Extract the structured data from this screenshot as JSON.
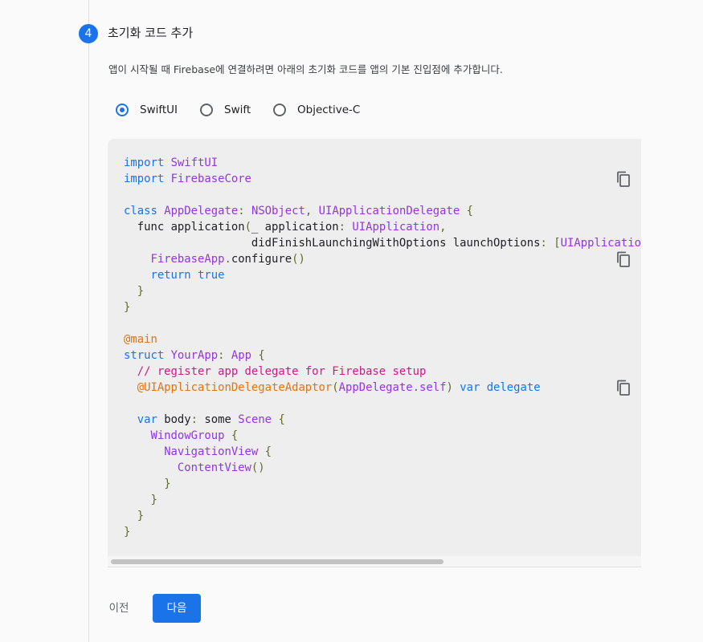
{
  "step": {
    "number": "4",
    "title": "초기화 코드 추가"
  },
  "description": "앱이 시작될 때 Firebase에 연결하려면 아래의 초기화 코드를 앱의 기본 진입점에 추가합니다.",
  "language_options": [
    {
      "label": "SwiftUI",
      "selected": true
    },
    {
      "label": "Swift",
      "selected": false
    },
    {
      "label": "Objective-C",
      "selected": false
    }
  ],
  "code_tokens": {
    "import": "import",
    "swiftui": "SwiftUI",
    "firebasecore": "FirebaseCore",
    "class": "class",
    "appdelegate": "AppDelegate",
    "colon": ":",
    "nsobject": "NSObject",
    "comma": ",",
    "uiappdelegate": "UIApplicationDelegate",
    "lbrace": "{",
    "rbrace": "}",
    "func": "func",
    "application_fn": "application",
    "lparen": "(",
    "rparen": ")",
    "underscore_application": "_ application",
    "uiapplication": "UIApplication",
    "did_finish": "didFinishLaunchingWithOptions launchOptions",
    "lbracket": "[",
    "uiapplication_cut": "UIApplicatio",
    "firebaseapp": "FirebaseApp",
    "dot": ".",
    "configure": "configure",
    "parens": "()",
    "return": "return",
    "true": "true",
    "main_attr": "@main",
    "struct": "struct",
    "yourapp": "YourApp",
    "app": "App",
    "comment": "// register app delegate for Firebase setup",
    "adaptor_attr": "@UIApplicationDelegateAdaptor",
    "self": "self",
    "var": "var",
    "delegate": "delegate",
    "body": "body",
    "some": "some",
    "scene": "Scene",
    "windowgroup": "WindowGroup",
    "navigationview": "NavigationView",
    "contentview": "ContentView"
  },
  "icons": {
    "copy": "copy-icon"
  },
  "buttons": {
    "prev": "이전",
    "next": "다음"
  },
  "colors": {
    "accent": "#1a73e8",
    "keyword": "#1a73e8",
    "type": "#9334e6",
    "attribute": "#e8710a",
    "comment": "#d01884",
    "punctuation": "#5f6d2a"
  }
}
